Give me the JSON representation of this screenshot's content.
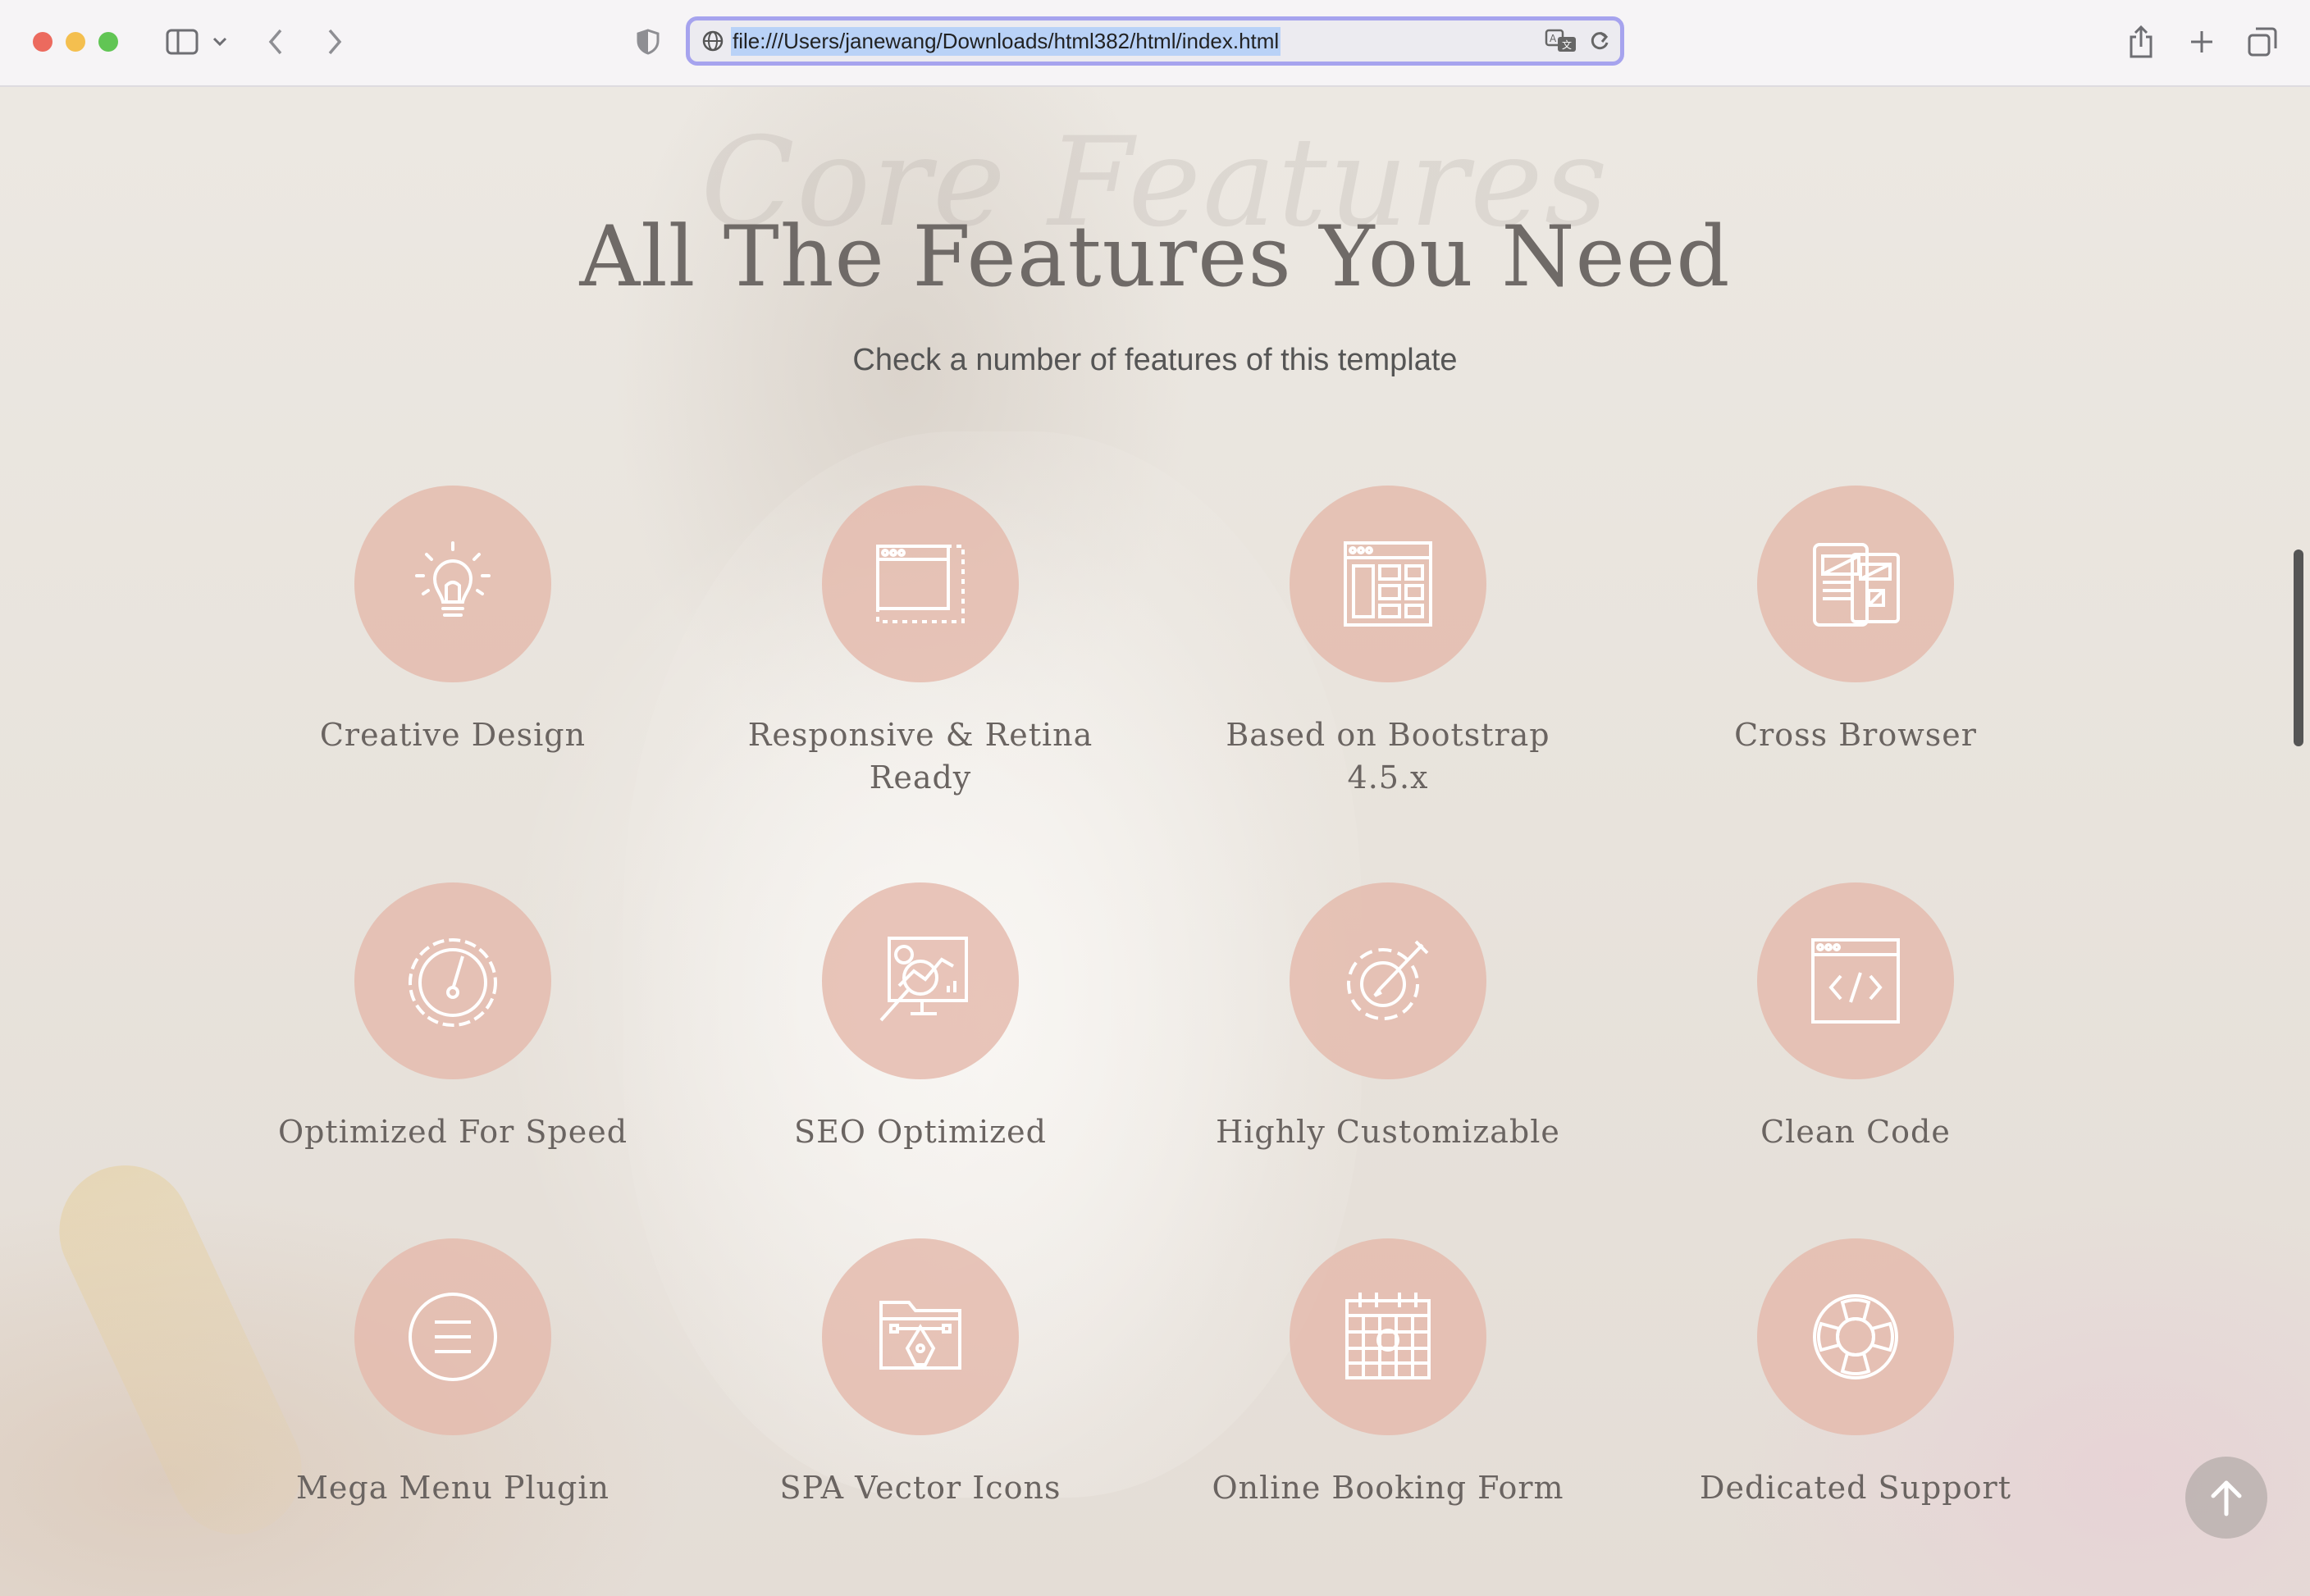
{
  "browser": {
    "url": "file:///Users/janewang/Downloads/html382/html/index.html"
  },
  "section": {
    "script_title": "Core Features",
    "title": "All The Features You Need",
    "subtitle": "Check a number of features of this template"
  },
  "features": [
    {
      "label": "Creative Design",
      "icon": "lightbulb-icon"
    },
    {
      "label": "Responsive & Retina Ready",
      "icon": "browser-window-icon"
    },
    {
      "label": "Based on Bootstrap 4.5.x",
      "icon": "grid-layout-icon"
    },
    {
      "label": "Cross Browser",
      "icon": "devices-icon"
    },
    {
      "label": "Optimized For Speed",
      "icon": "speedometer-icon"
    },
    {
      "label": "SEO Optimized",
      "icon": "analytics-monitor-icon"
    },
    {
      "label": "Highly Customizable",
      "icon": "gear-pencil-icon"
    },
    {
      "label": "Clean Code",
      "icon": "code-window-icon"
    },
    {
      "label": "Mega Menu Plugin",
      "icon": "menu-icon"
    },
    {
      "label": "SPA Vector Icons",
      "icon": "folder-pen-icon"
    },
    {
      "label": "Online Booking Form",
      "icon": "calendar-icon"
    },
    {
      "label": "Dedicated Support",
      "icon": "lifebuoy-icon"
    }
  ],
  "colors": {
    "circle": "#e4baac",
    "accent_url_border": "#a6a3ee"
  }
}
